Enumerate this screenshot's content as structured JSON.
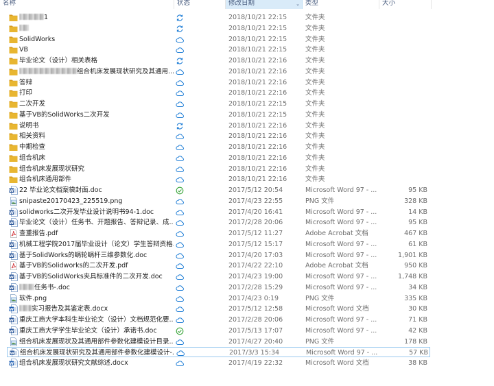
{
  "header": {
    "name": "名称",
    "status": "状态",
    "date": "修改日期",
    "type": "类型",
    "size": "大小"
  },
  "colors": {
    "folder": "#e8b631",
    "folder_dark": "#d69a1d",
    "sync_blue": "#1f7ed6",
    "synced_green": "#3aa53a",
    "word_blue": "#2b579a",
    "pdf_red": "#d13438",
    "selection_border": "#99c9ef",
    "sorted_header": "#d9ebf9"
  },
  "files": [
    {
      "name": "1",
      "blur": 36,
      "icon": "folder-icon",
      "status": "sync-icon",
      "date": "2018/10/21 22:15",
      "type": "文件夹",
      "size": ""
    },
    {
      "name": "",
      "blur": 14,
      "icon": "folder-icon",
      "status": "sync-icon",
      "date": "2018/10/21 22:15",
      "type": "文件夹",
      "size": ""
    },
    {
      "name": "SolidWorks",
      "icon": "folder-icon",
      "status": "cloud-icon",
      "date": "2018/10/21 22:15",
      "type": "文件夹",
      "size": ""
    },
    {
      "name": "VB",
      "icon": "folder-icon",
      "status": "cloud-icon",
      "date": "2018/10/21 22:15",
      "type": "文件夹",
      "size": ""
    },
    {
      "name": "毕业论文（设计）相关表格",
      "icon": "folder-icon",
      "status": "sync-icon",
      "date": "2018/10/21 22:16",
      "type": "文件夹",
      "size": ""
    },
    {
      "name": "组合机床发展现状研究及其通用...",
      "blur": 84,
      "icon": "folder-icon",
      "status": "cloud-icon",
      "date": "2018/10/21 22:16",
      "type": "文件夹",
      "size": ""
    },
    {
      "name": "答辩",
      "icon": "folder-icon",
      "status": "cloud-icon",
      "date": "2018/10/21 22:16",
      "type": "文件夹",
      "size": ""
    },
    {
      "name": "打印",
      "icon": "folder-icon",
      "status": "cloud-icon",
      "date": "2018/10/21 22:16",
      "type": "文件夹",
      "size": ""
    },
    {
      "name": "二次开发",
      "icon": "folder-icon",
      "status": "cloud-icon",
      "date": "2018/10/21 22:15",
      "type": "文件夹",
      "size": ""
    },
    {
      "name": "基于VB的SolidWorks二次开发",
      "icon": "folder-icon",
      "status": "cloud-icon",
      "date": "2018/10/21 22:15",
      "type": "文件夹",
      "size": ""
    },
    {
      "name": "说明书",
      "icon": "folder-icon",
      "status": "sync-icon",
      "date": "2018/10/21 22:16",
      "type": "文件夹",
      "size": ""
    },
    {
      "name": "相关资料",
      "icon": "folder-icon",
      "status": "cloud-icon",
      "date": "2018/10/21 22:16",
      "type": "文件夹",
      "size": ""
    },
    {
      "name": "中期检查",
      "icon": "folder-icon",
      "status": "cloud-icon",
      "date": "2018/10/21 22:16",
      "type": "文件夹",
      "size": ""
    },
    {
      "name": "组合机床",
      "icon": "folder-icon",
      "status": "cloud-icon",
      "date": "2018/10/21 22:16",
      "type": "文件夹",
      "size": ""
    },
    {
      "name": "组合机床发展现状研究",
      "icon": "folder-icon",
      "status": "cloud-icon",
      "date": "2018/10/21 22:16",
      "type": "文件夹",
      "size": ""
    },
    {
      "name": "组合机床通用部件",
      "icon": "folder-icon",
      "status": "cloud-icon",
      "date": "2018/10/21 22:16",
      "type": "文件夹",
      "size": ""
    },
    {
      "name": "22 毕业论文档案袋封面.doc",
      "icon": "word-doc-icon",
      "status": "check-icon",
      "date": "2017/5/12 20:54",
      "type": "Microsoft Word 97 - ...",
      "size": "95 KB"
    },
    {
      "name": "snipaste20170423_225519.png",
      "icon": "png-image-icon",
      "status": "cloud-icon",
      "date": "2017/4/23 22:55",
      "type": "PNG 文件",
      "size": "328 KB"
    },
    {
      "name": "solidworks二次开发毕业设计说明书94-1.doc",
      "icon": "word-doc-icon",
      "status": "cloud-icon",
      "date": "2017/4/20 16:41",
      "type": "Microsoft Word 97 - ...",
      "size": "14 KB"
    },
    {
      "name": "毕业论文（设计）任务书、开题报告、答辩记录、成...",
      "icon": "word-doc-icon",
      "status": "cloud-icon",
      "date": "2017/2/28 20:06",
      "type": "Microsoft Word 97 - ...",
      "size": "95 KB"
    },
    {
      "name": "查重报告.pdf",
      "icon": "pdf-icon",
      "status": "cloud-icon",
      "date": "2017/5/12 11:27",
      "type": "Adobe Acrobat 文档",
      "size": "467 KB"
    },
    {
      "name": "机械工程学院2017届毕业设计（论文）学生答辩资格...",
      "icon": "word-doc-icon",
      "status": "cloud-icon",
      "date": "2017/5/12 15:17",
      "type": "Microsoft Word 97 - ...",
      "size": "61 KB"
    },
    {
      "name": "基于SolidWorks的蜗轮蜗杆三维参数化.doc",
      "icon": "word-doc-icon",
      "status": "cloud-icon",
      "date": "2017/4/20 17:03",
      "type": "Microsoft Word 97 - ...",
      "size": "1,901 KB"
    },
    {
      "name": "基于VB的Solidworks的二次开发.pdf",
      "icon": "pdf-icon",
      "status": "cloud-icon",
      "date": "2017/4/22 22:10",
      "type": "Adobe Acrobat 文档",
      "size": "950 KB"
    },
    {
      "name": "基于VB的SolidWorks夹具标准件的二次开发.doc",
      "icon": "word-doc-icon",
      "status": "cloud-icon",
      "date": "2017/4/23 19:00",
      "type": "Microsoft Word 97 - ...",
      "size": "1,748 KB"
    },
    {
      "name": "任务书-.doc",
      "blur": 22,
      "icon": "word-doc-icon",
      "status": "cloud-icon",
      "date": "2017/2/28 15:29",
      "type": "Microsoft Word 97 - ...",
      "size": "34 KB"
    },
    {
      "name": "软件.png",
      "icon": "png-image-icon",
      "status": "cloud-icon",
      "date": "2017/4/23 0:19",
      "type": "PNG 文件",
      "size": "335 KB"
    },
    {
      "name": "实习报告及其鉴定表.docx",
      "blur": 18,
      "icon": "word-docx-icon",
      "status": "cloud-icon",
      "date": "2017/5/12 12:58",
      "type": "Microsoft Word 文档",
      "size": "30 KB"
    },
    {
      "name": "重庆工商大学本科生毕业论文（设计）文档规范化要...",
      "icon": "word-doc-icon",
      "status": "cloud-icon",
      "date": "2017/2/28 20:06",
      "type": "Microsoft Word 97 - ...",
      "size": "71 KB"
    },
    {
      "name": "重庆工商大学学生毕业论文（设计）承诺书.doc",
      "icon": "word-doc-icon",
      "status": "check-icon",
      "date": "2017/5/13 17:07",
      "type": "Microsoft Word 97 - ...",
      "size": "42 KB"
    },
    {
      "name": "组合机床发展现状及其通用部件参数化建模设计目录....",
      "icon": "png-image-icon",
      "status": "cloud-icon",
      "date": "2017/4/27 20:40",
      "type": "PNG 文件",
      "size": "178 KB"
    },
    {
      "name": "组合机床发展现状研究及其通用部件参数化建模设计-...",
      "icon": "word-doc-icon",
      "status": "cloud-icon",
      "date": "2017/3/3 15:34",
      "type": "Microsoft Word 97 - ...",
      "size": "57 KB",
      "selected": true
    },
    {
      "name": "组合机床发展现状研究文献综述.docx",
      "icon": "word-docx-icon",
      "status": "cloud-icon",
      "date": "2017/4/19 22:32",
      "type": "Microsoft Word 文档",
      "size": "38 KB"
    }
  ]
}
